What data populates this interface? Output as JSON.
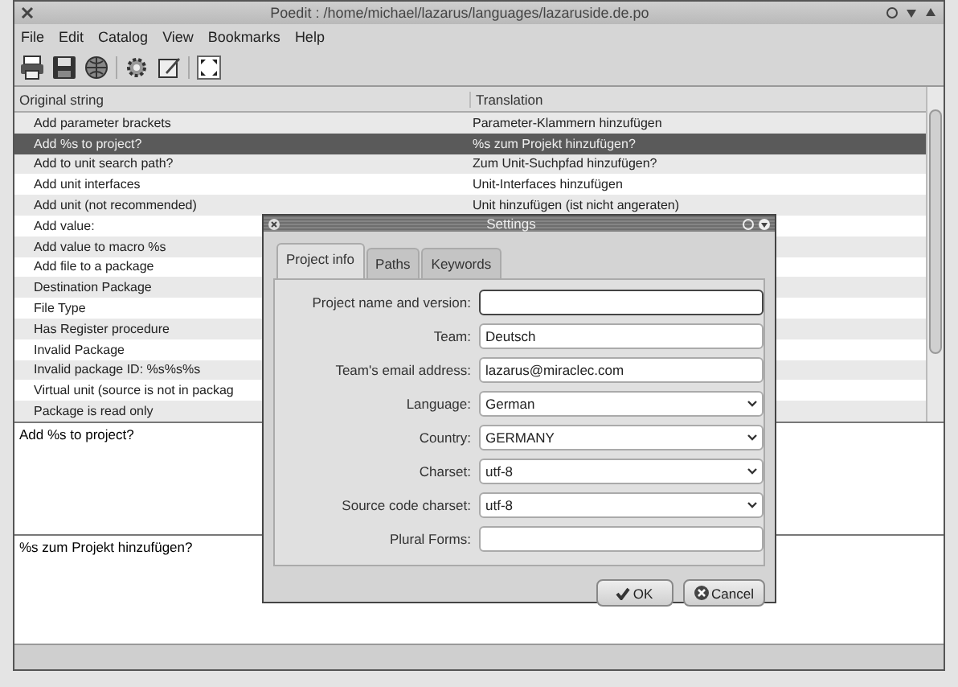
{
  "window": {
    "title": "Poedit : /home/michael/lazarus/languages/lazaruside.de.po"
  },
  "menu": [
    "File",
    "Edit",
    "Catalog",
    "View",
    "Bookmarks",
    "Help"
  ],
  "toolbar": [
    {
      "kind": "printer"
    },
    {
      "kind": "save"
    },
    {
      "kind": "globe"
    },
    {
      "kind": "separator"
    },
    {
      "kind": "gear"
    },
    {
      "kind": "edit"
    },
    {
      "kind": "separator"
    },
    {
      "kind": "fullscreen"
    }
  ],
  "table": {
    "columns": [
      "Original string",
      "Translation"
    ],
    "rows": [
      {
        "original": "Add parameter brackets",
        "translation": "Parameter-Klammern hinzufügen",
        "selected": false
      },
      {
        "original": "Add %s to project?",
        "translation": "%s zum Projekt hinzufügen?",
        "selected": true
      },
      {
        "original": "Add to unit search path?",
        "translation": "Zum Unit-Suchpfad hinzufügen?",
        "selected": false
      },
      {
        "original": "Add unit interfaces",
        "translation": "Unit-Interfaces hinzufügen",
        "selected": false
      },
      {
        "original": "Add unit (not recommended)",
        "translation": "Unit hinzufügen (ist nicht angeraten)",
        "selected": false
      },
      {
        "original": "Add value:",
        "selected": false
      },
      {
        "original": "Add value to macro %s",
        "selected": false
      },
      {
        "original": "Add file to a package",
        "selected": false
      },
      {
        "original": "Destination Package",
        "selected": false
      },
      {
        "original": "File Type",
        "selected": false
      },
      {
        "original": "Has Register procedure",
        "selected": false
      },
      {
        "original": "Invalid Package",
        "selected": false
      },
      {
        "original": "Invalid package ID: %s%s%s",
        "selected": false
      },
      {
        "original": "Virtual unit (source is not in packag",
        "selected": false
      },
      {
        "original": "Package is read only",
        "selected": false
      }
    ]
  },
  "source_text": "Add %s to project?",
  "translation_text": "%s zum Projekt hinzufügen?",
  "dialog": {
    "title": "Settings",
    "tabs": [
      {
        "label": "Project info",
        "selected": true
      },
      {
        "label": "Paths",
        "selected": false
      },
      {
        "label": "Keywords",
        "selected": false
      }
    ],
    "fields": [
      {
        "label": "Project name and version:",
        "kind": "text",
        "focused": true
      },
      {
        "label": "Team:",
        "kind": "text",
        "value": "Deutsch",
        "focused": false
      },
      {
        "label": "Team's email address:",
        "kind": "text",
        "value": "lazarus@miraclec.com",
        "focused": false
      },
      {
        "label": "Language:",
        "kind": "select",
        "value": "German",
        "focused": false
      },
      {
        "label": "Country:",
        "kind": "select",
        "value": "GERMANY",
        "focused": false
      },
      {
        "label": "Charset:",
        "kind": "select",
        "value": "utf-8",
        "focused": false
      },
      {
        "label": "Source code charset:",
        "kind": "select",
        "value": "utf-8",
        "focused": false
      },
      {
        "label": "Plural Forms:",
        "kind": "text",
        "focused": false
      }
    ],
    "buttons": [
      {
        "label": "OK",
        "kind": "ok"
      },
      {
        "label": "Cancel",
        "kind": "cancel"
      }
    ]
  }
}
